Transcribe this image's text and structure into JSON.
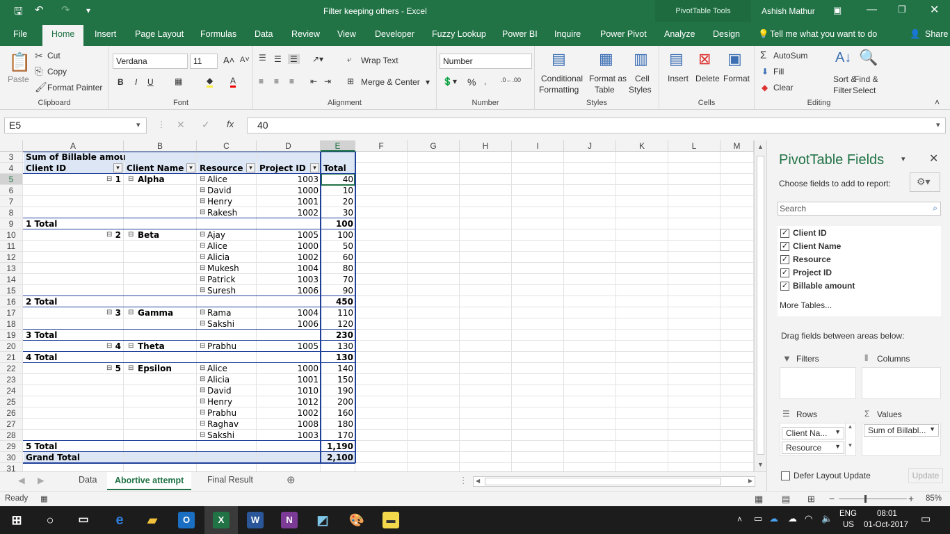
{
  "window": {
    "title": "Filter keeping others  -  Excel",
    "context_tab": "PivotTable Tools",
    "user": "Ashish Mathur"
  },
  "tabs": [
    "File",
    "Home",
    "Insert",
    "Page Layout",
    "Formulas",
    "Data",
    "Review",
    "View",
    "Developer",
    "Fuzzy Lookup",
    "Power BI",
    "Inquire",
    "Power Pivot",
    "Analyze",
    "Design"
  ],
  "tell_me": "Tell me what you want to do",
  "share": "Share",
  "ribbon": {
    "clipboard": {
      "paste": "Paste",
      "cut": "Cut",
      "copy": "Copy",
      "format_painter": "Format Painter",
      "label": "Clipboard"
    },
    "font": {
      "name": "Verdana",
      "size": "11",
      "label": "Font"
    },
    "alignment": {
      "wrap": "Wrap Text",
      "merge": "Merge & Center",
      "label": "Alignment"
    },
    "number": {
      "format": "Number",
      "label": "Number"
    },
    "styles": {
      "conditional": "Conditional",
      "conditional2": "Formatting",
      "format_as": "Format as",
      "format_as2": "Table",
      "cell": "Cell",
      "cell2": "Styles",
      "label": "Styles"
    },
    "cells": {
      "insert": "Insert",
      "delete": "Delete",
      "format": "Format",
      "label": "Cells"
    },
    "editing": {
      "autosum": "AutoSum",
      "fill": "Fill",
      "clear": "Clear",
      "sort": "Sort &",
      "sort2": "Filter",
      "find": "Find &",
      "find2": "Select",
      "label": "Editing"
    }
  },
  "formula_bar": {
    "name_box": "E5",
    "value": "40"
  },
  "columns": [
    "A",
    "B",
    "C",
    "D",
    "E",
    "F",
    "G",
    "H",
    "I",
    "J",
    "K",
    "L",
    "M"
  ],
  "pivot": {
    "title": "Sum of Billable amou",
    "headers": {
      "client_id": "Client ID",
      "client_name": "Client Name",
      "resource": "Resource",
      "project_id": "Project ID",
      "total": "Total"
    },
    "rows": [
      {
        "row": "3",
        "a": "Sum of Billable amou",
        "b": "",
        "c": "",
        "d": "",
        "e": "",
        "kind": "title"
      },
      {
        "row": "4",
        "a": "Client ID",
        "b": "Client Name",
        "c": "Resource",
        "d": "Project ID",
        "e": "Total",
        "kind": "header"
      },
      {
        "row": "5",
        "a": "1",
        "b": "Alpha",
        "c": "Alice",
        "d": "1003",
        "e": "40",
        "kind": "first"
      },
      {
        "row": "6",
        "a": "",
        "b": "",
        "c": "David",
        "d": "1000",
        "e": "10",
        "kind": "item"
      },
      {
        "row": "7",
        "a": "",
        "b": "",
        "c": "Henry",
        "d": "1001",
        "e": "20",
        "kind": "item"
      },
      {
        "row": "8",
        "a": "",
        "b": "",
        "c": "Rakesh",
        "d": "1002",
        "e": "30",
        "kind": "item"
      },
      {
        "row": "9",
        "a": "1 Total",
        "b": "",
        "c": "",
        "d": "",
        "e": "100",
        "kind": "subtotal"
      },
      {
        "row": "10",
        "a": "2",
        "b": "Beta",
        "c": "Ajay",
        "d": "1005",
        "e": "100",
        "kind": "first"
      },
      {
        "row": "11",
        "a": "",
        "b": "",
        "c": "Alice",
        "d": "1000",
        "e": "50",
        "kind": "item"
      },
      {
        "row": "12",
        "a": "",
        "b": "",
        "c": "Alicia",
        "d": "1002",
        "e": "60",
        "kind": "item"
      },
      {
        "row": "13",
        "a": "",
        "b": "",
        "c": "Mukesh",
        "d": "1004",
        "e": "80",
        "kind": "item"
      },
      {
        "row": "14",
        "a": "",
        "b": "",
        "c": "Patrick",
        "d": "1003",
        "e": "70",
        "kind": "item"
      },
      {
        "row": "15",
        "a": "",
        "b": "",
        "c": "Suresh",
        "d": "1006",
        "e": "90",
        "kind": "item"
      },
      {
        "row": "16",
        "a": "2 Total",
        "b": "",
        "c": "",
        "d": "",
        "e": "450",
        "kind": "subtotal"
      },
      {
        "row": "17",
        "a": "3",
        "b": "Gamma",
        "c": "Rama",
        "d": "1004",
        "e": "110",
        "kind": "first"
      },
      {
        "row": "18",
        "a": "",
        "b": "",
        "c": "Sakshi",
        "d": "1006",
        "e": "120",
        "kind": "item"
      },
      {
        "row": "19",
        "a": "3 Total",
        "b": "",
        "c": "",
        "d": "",
        "e": "230",
        "kind": "subtotal"
      },
      {
        "row": "20",
        "a": "4",
        "b": "Theta",
        "c": "Prabhu",
        "d": "1005",
        "e": "130",
        "kind": "first"
      },
      {
        "row": "21",
        "a": "4 Total",
        "b": "",
        "c": "",
        "d": "",
        "e": "130",
        "kind": "subtotal"
      },
      {
        "row": "22",
        "a": "5",
        "b": "Epsilon",
        "c": "Alice",
        "d": "1000",
        "e": "140",
        "kind": "first"
      },
      {
        "row": "23",
        "a": "",
        "b": "",
        "c": "Alicia",
        "d": "1001",
        "e": "150",
        "kind": "item"
      },
      {
        "row": "24",
        "a": "",
        "b": "",
        "c": "David",
        "d": "1010",
        "e": "190",
        "kind": "item"
      },
      {
        "row": "25",
        "a": "",
        "b": "",
        "c": "Henry",
        "d": "1012",
        "e": "200",
        "kind": "item"
      },
      {
        "row": "26",
        "a": "",
        "b": "",
        "c": "Prabhu",
        "d": "1002",
        "e": "160",
        "kind": "item"
      },
      {
        "row": "27",
        "a": "",
        "b": "",
        "c": "Raghav",
        "d": "1008",
        "e": "180",
        "kind": "item"
      },
      {
        "row": "28",
        "a": "",
        "b": "",
        "c": "Sakshi",
        "d": "1003",
        "e": "170",
        "kind": "item"
      },
      {
        "row": "29",
        "a": "5 Total",
        "b": "",
        "c": "",
        "d": "",
        "e": "1,190",
        "kind": "subtotal"
      },
      {
        "row": "30",
        "a": "Grand Total",
        "b": "",
        "c": "",
        "d": "",
        "e": "2,100",
        "kind": "grand"
      },
      {
        "row": "31",
        "a": "",
        "b": "",
        "c": "",
        "d": "",
        "e": "",
        "kind": "empty"
      }
    ]
  },
  "sheets": [
    "Data",
    "Abortive attempt",
    "Final Result"
  ],
  "active_sheet": "Abortive attempt",
  "status": {
    "ready": "Ready",
    "zoom": "85%"
  },
  "panel": {
    "title": "PivotTable Fields",
    "choose": "Choose fields to add to report:",
    "search_placeholder": "Search",
    "fields": [
      "Client ID",
      "Client Name",
      "Resource",
      "Project ID",
      "Billable amount"
    ],
    "more_tables": "More Tables...",
    "drag": "Drag fields between areas below:",
    "filters": "Filters",
    "columns": "Columns",
    "rows": "Rows",
    "values": "Values",
    "row_items": [
      "Client Na...",
      "Resource"
    ],
    "value_items": [
      "Sum of Billabl..."
    ],
    "defer": "Defer Layout Update",
    "update": "Update"
  },
  "taskbar": {
    "lang": "ENG",
    "region": "US",
    "time": "08:01",
    "date": "01-Oct-2017"
  },
  "colors": {
    "excel_green": "#217346",
    "pivot_blue": "#1f3f99",
    "header_fill": "#dce6f5"
  }
}
